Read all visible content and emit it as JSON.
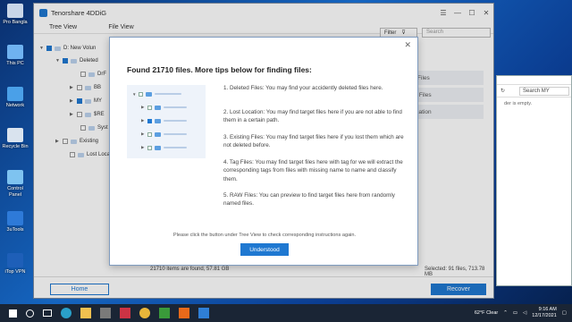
{
  "desktop": {
    "icons": [
      {
        "label": "Pro Bangla"
      },
      {
        "label": "This PC"
      },
      {
        "label": "Network"
      },
      {
        "label": "Recycle Bin"
      },
      {
        "label": "Control Panel"
      },
      {
        "label": "3uTools"
      },
      {
        "label": "iTop VPN"
      }
    ]
  },
  "explorer_bg": {
    "search_placeholder": "Search MY",
    "empty_text": "der is empty."
  },
  "app": {
    "title": "Tenorshare 4DDiG",
    "tabs": [
      {
        "label": "Tree View"
      },
      {
        "label": "File View"
      }
    ],
    "filter_label": "Filter",
    "search_placeholder": "Search",
    "tree": [
      {
        "label": "D: New Volun"
      },
      {
        "label": "Deleted"
      },
      {
        "label": "DrF"
      },
      {
        "label": "BB"
      },
      {
        "label": "MY"
      },
      {
        "label": "$RE"
      },
      {
        "label": "Syst"
      },
      {
        "label": "Existing"
      },
      {
        "label": "Lost Loca"
      }
    ],
    "right_items": [
      {
        "label": "ed Files"
      },
      {
        "label": "Ing Files"
      },
      {
        "label": "Location"
      }
    ],
    "status_left": "21710 items are found, 57.81 GB",
    "status_right": "Selected: 91 files, 713.78 MB",
    "home_label": "Home",
    "recover_label": "Recover"
  },
  "modal": {
    "title": "Found 21710 files. More tips below for finding files:",
    "tips": [
      "1. Deleted Files: You may find your accidently deleted files here.",
      "2. Lost Location: You may find target files here if you are not able to find them in a certain path.",
      "3. Existing Files: You may find target files here if you lost them which are not deleted before.",
      "4. Tag Files: You may find target files here with tag for we will extract the corresponding tags from files with missing name to name and classify them.",
      "5. RAW Files: You can preview to find target files here from randomly named files."
    ],
    "note": "Please click the button under Tree View to check corresponding instructions again.",
    "button_label": "Understood"
  },
  "taskbar": {
    "weather": "62°F  Clear",
    "time": "9:16 AM",
    "date": "12/17/2021"
  },
  "colors": {
    "accent": "#1f78d1"
  }
}
